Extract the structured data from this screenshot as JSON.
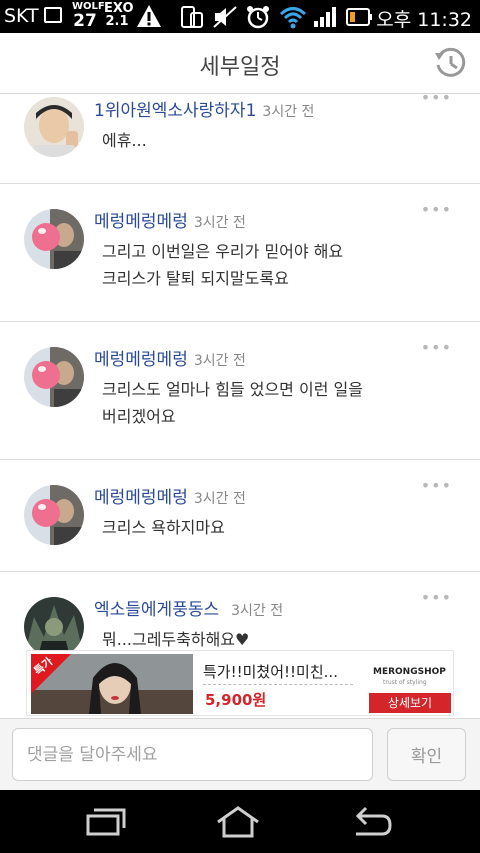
{
  "status_bar": {
    "carrier": "SKT",
    "wolf_label": "WOLF",
    "wolf_value": "27",
    "exo_label": "EXO",
    "exo_value": "2.1",
    "ampm": "오후",
    "time": "11:32"
  },
  "header": {
    "title": "세부일정"
  },
  "comments": [
    {
      "author": "1위아원엑소사랑하자1",
      "time": "3시간 전",
      "lines": [
        "에휴..."
      ]
    },
    {
      "author": "메렁메렁메렁",
      "time": "3시간 전",
      "lines": [
        "그리고 이번일은 우리가 믿어야 해요",
        "크리스가 탈퇴 되지말도록요"
      ]
    },
    {
      "author": "메렁메렁메렁",
      "time": "3시간 전",
      "lines": [
        "크리스도 얼마나 힘들 었으면 이런 일을",
        "버리겠어요"
      ]
    },
    {
      "author": "메렁메렁메렁",
      "time": "3시간 전",
      "lines": [
        "크리스 욕하지마요"
      ]
    },
    {
      "author": "엑소들에게풍동스",
      "time": "3시간 전",
      "lines": [
        "뭐...그레두축하해요♥"
      ]
    }
  ],
  "more_label": "•••",
  "ad": {
    "badge": "특가",
    "title": "특가!!미쳤어!!미친...",
    "price": "5,900원",
    "brand": "MERONGSHOP",
    "brand_sub": "trust of styling",
    "button": "상세보기"
  },
  "input": {
    "placeholder": "댓글을 달아주세요",
    "confirm": "확인"
  },
  "colors": {
    "author": "#2b4a9a",
    "accent_red": "#d4262a"
  }
}
